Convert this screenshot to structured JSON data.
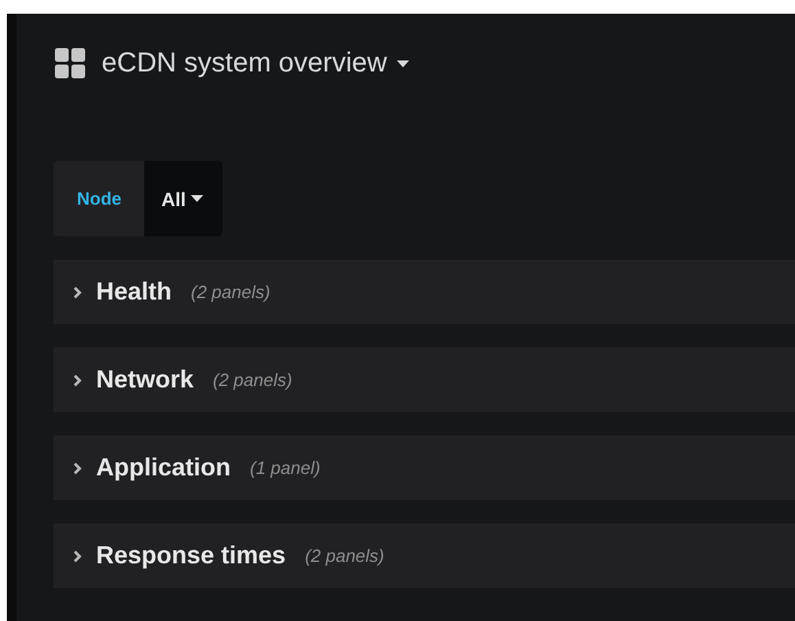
{
  "dashboard": {
    "title": "eCDN system overview"
  },
  "variables": [
    {
      "label": "Node",
      "value": "All"
    }
  ],
  "rows": [
    {
      "title": "Health",
      "count": "(2 panels)",
      "expanded": false
    },
    {
      "title": "Network",
      "count": "(2 panels)",
      "expanded": false
    },
    {
      "title": "Application",
      "count": "(1 panel)",
      "expanded": false
    },
    {
      "title": "Response times",
      "count": "(2 panels)",
      "expanded": false
    }
  ]
}
